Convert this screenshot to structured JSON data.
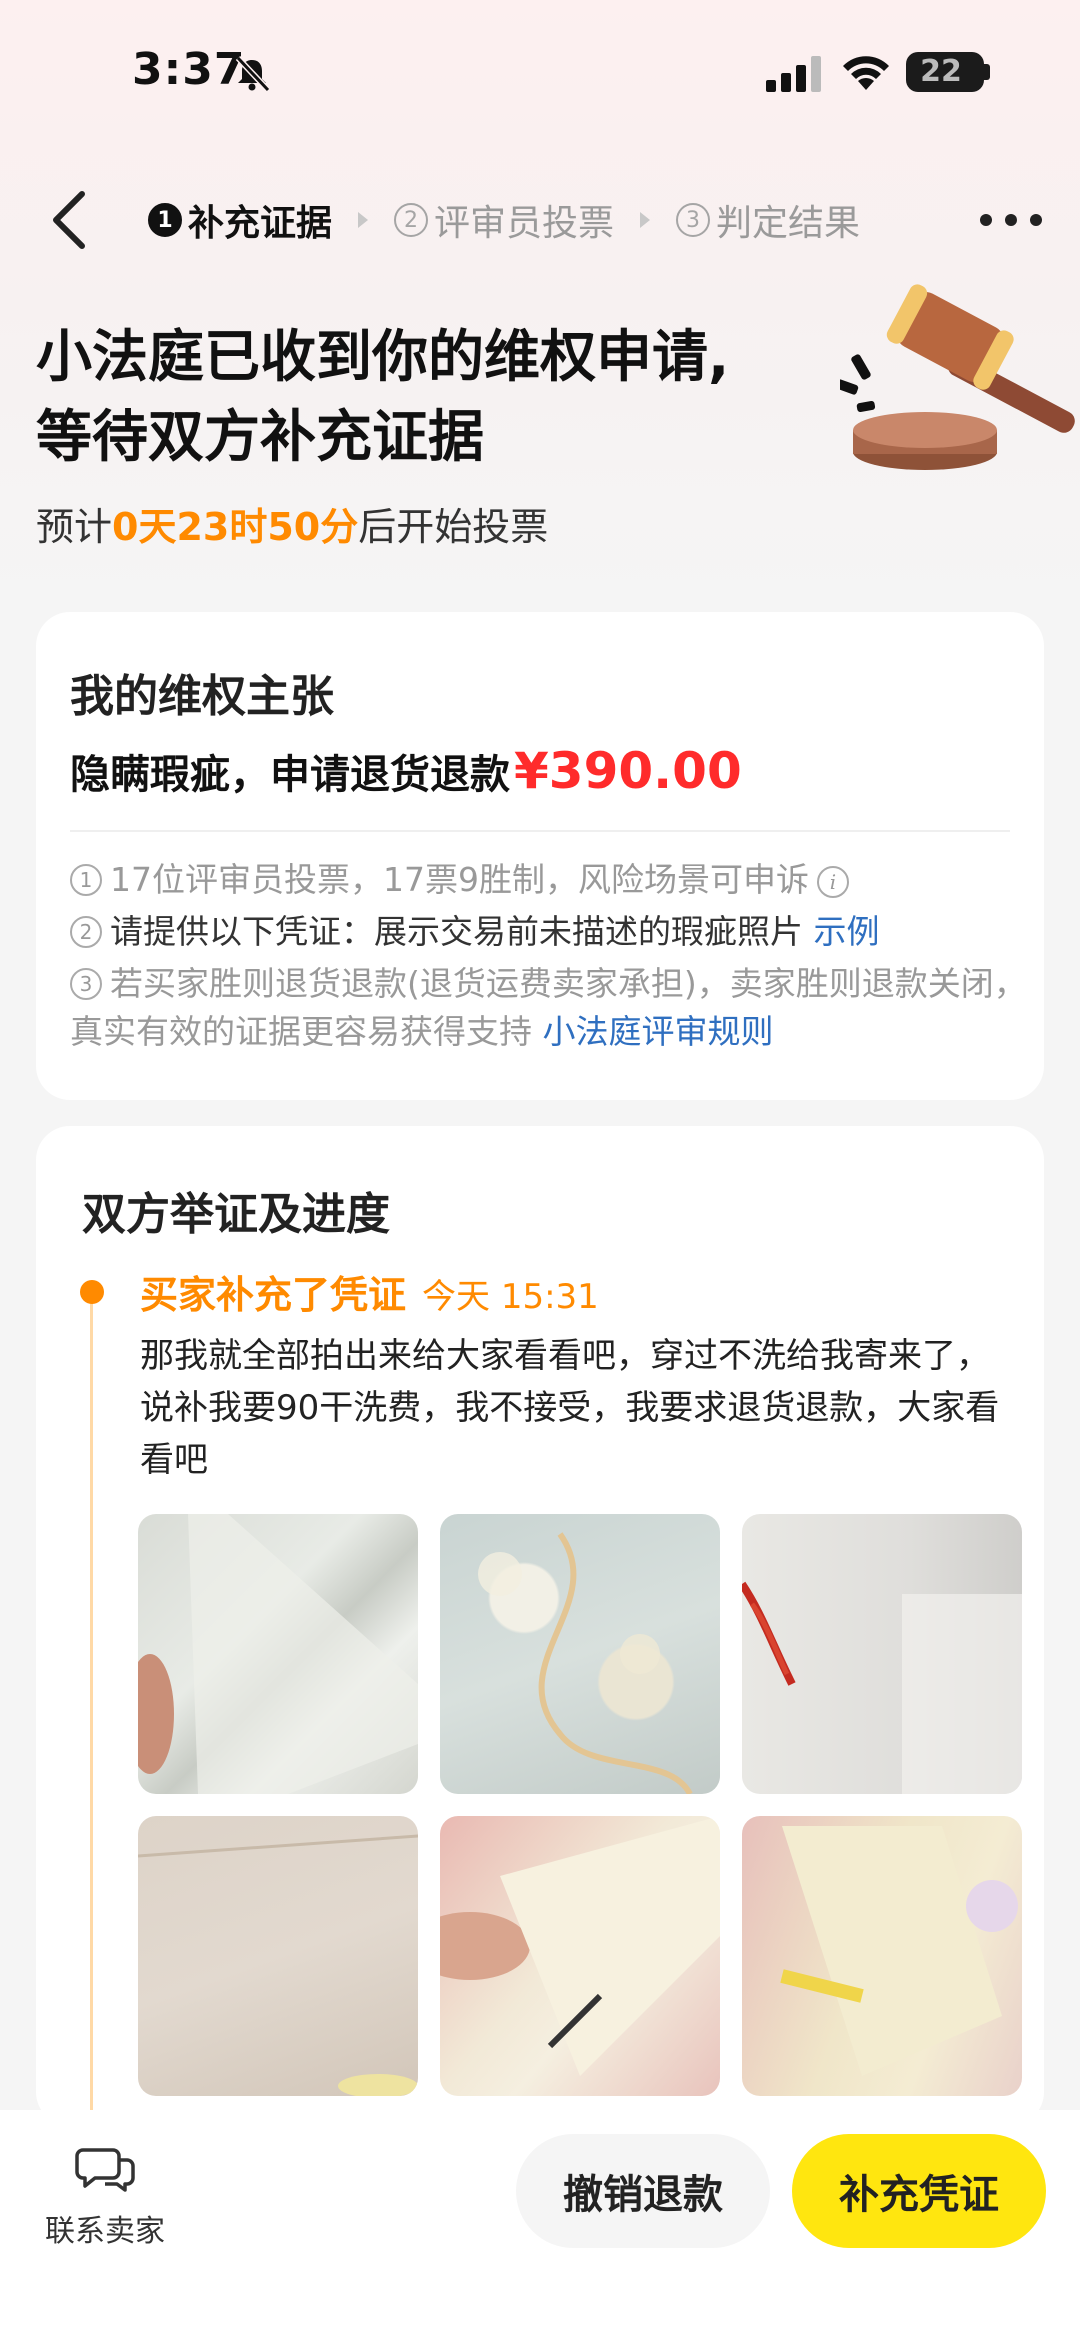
{
  "status_bar": {
    "time": "3:37",
    "battery": "22"
  },
  "steps": [
    {
      "num": "1",
      "label": "补充证据"
    },
    {
      "num": "2",
      "label": "评审员投票"
    },
    {
      "num": "3",
      "label": "判定结果"
    }
  ],
  "hero": {
    "title_line1": "小法庭已收到你的维权申请,",
    "title_line2": "等待双方补充证据",
    "sub_prefix": "预计",
    "sub_time": "0天23时50分",
    "sub_suffix": "后开始投票"
  },
  "claim_card": {
    "title": "我的维权主张",
    "claim_text": "隐瞒瑕疵，申请退货退款",
    "amount": "¥390.00",
    "rules": [
      {
        "num": "1",
        "text": "17位评审员投票，17票9胜制，风险场景可申诉"
      },
      {
        "num": "2",
        "text": "请提供以下凭证：展示交易前未描述的瑕疵照片",
        "link": "示例"
      },
      {
        "num": "3",
        "text": "若买家胜则退货退款(退货运费卖家承担)，卖家胜则退款关闭，真实有效的证据更容易获得支持",
        "link": "小法庭评审规则"
      }
    ]
  },
  "evidence_card": {
    "title": "双方举证及进度",
    "event": {
      "title": "买家补充了凭证",
      "time": "今天 15:31",
      "text": "那我就全部拍出来给大家看看吧，穿过不洗给我寄来了，说补我要90干洗费，我不接受，我要求退货退款，大家看看吧"
    }
  },
  "bottom_bar": {
    "contact_label": "联系卖家",
    "cancel_label": "撤销退款",
    "add_label": "补充凭证"
  },
  "colors": {
    "accent": "#ff8a00",
    "price": "#ff2b2b",
    "primary_button": "#ffe60f",
    "link": "#2f6fc0"
  }
}
